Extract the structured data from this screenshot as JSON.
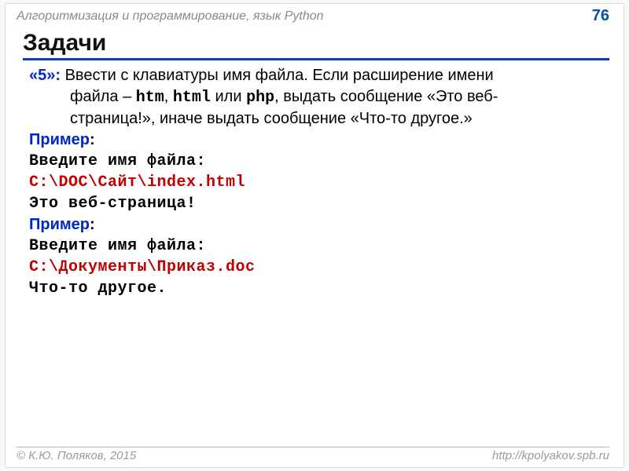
{
  "header": {
    "subject": "Алгоритмизация и программирование, язык Python",
    "page": "76"
  },
  "title": "Задачи",
  "task": {
    "level": "«5»:",
    "text_line1": " Ввести с клавиатуры имя файла. Если расширение имени",
    "text_line2_a": "файла – ",
    "ext1": "htm",
    "sep1": ", ",
    "ext2": "html",
    "sep2": " или ",
    "ext3": "php",
    "text_line2_b": ", выдать сообщение «Это веб-",
    "text_line3": "страница!», иначе выдать сообщение «Что-то другое.»"
  },
  "ex1": {
    "label": "Пример",
    "colon": ":",
    "prompt": "Введите имя файла:",
    "input": "C:\\DOC\\Сайт\\index.html",
    "output": "Это веб-страница!"
  },
  "ex2": {
    "label": "Пример",
    "colon": ":",
    "prompt": "Введите имя файла:",
    "input": "C:\\Документы\\Приказ.doc",
    "output": "Что-то другое."
  },
  "footer": {
    "copyright": "© К.Ю. Поляков, 2015",
    "url": "http://kpolyakov.spb.ru"
  }
}
